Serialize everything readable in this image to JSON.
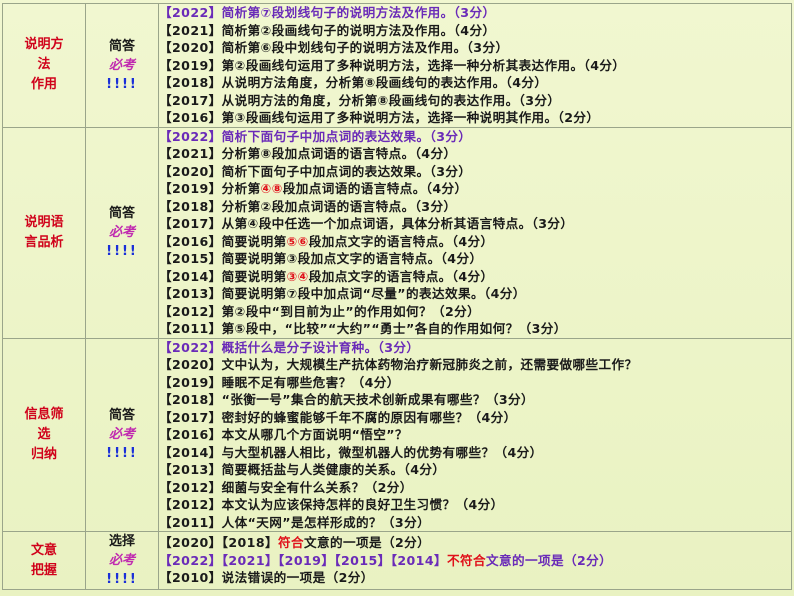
{
  "sections": [
    {
      "category_lines": [
        "说明方",
        "法",
        "作用"
      ],
      "type": "简答",
      "must": "必考",
      "marks": "!!!!",
      "items": [
        {
          "year": "【2022】",
          "text": "简析第⑦段划线句子的说明方法及作用。（3分）",
          "highlight": true
        },
        {
          "year": "【2021】",
          "text": "简析第②段画线句子的说明方法及作用。（4分）"
        },
        {
          "year": "【2020】",
          "text": "简析第⑥段中划线句子的说明方法及作用。（3分）"
        },
        {
          "year": "【2019】",
          "text": "第②段画线句运用了多种说明方法，选择一种分析其表达作用。（4分）"
        },
        {
          "year": "【2018】",
          "text": "从说明方法角度，分析第⑧段画线句的表达作用。（4分）"
        },
        {
          "year": "【2017】",
          "text": "从说明方法的角度，分析第⑧段画线句的表达作用。（3分）"
        },
        {
          "year": "【2016】",
          "text": "第③段画线句运用了多种说明方法，选择一种说明其作用。（2分）"
        }
      ]
    },
    {
      "category_lines": [
        "说明语",
        "言品析"
      ],
      "type": "简答",
      "must": "必考",
      "marks": "!!!!",
      "items": [
        {
          "year": "【2022】",
          "text": "简析下面句子中加点词的表达效果。（3分）",
          "highlight": true
        },
        {
          "year": "【2021】",
          "text": "分析第⑧段加点词语的语言特点。（4分）"
        },
        {
          "year": "【2020】",
          "text": "简析下面句子中加点词的表达效果。（3分）"
        },
        {
          "year": "【2019】",
          "pre": "分析第",
          "red": "④⑧",
          "post": "段加点词语的语言特点。（4分）"
        },
        {
          "year": "【2018】",
          "text": "分析第②段加点词语的语言特点。（3分）"
        },
        {
          "year": "【2017】",
          "text": "从第④段中任选一个加点词语，具体分析其语言特点。（3分）"
        },
        {
          "year": "【2016】",
          "pre": "简要说明第",
          "red": "⑤⑥",
          "post": "段加点文字的语言特点。（4分）"
        },
        {
          "year": "【2015】",
          "text": "简要说明第③段加点文字的语言特点。（4分）"
        },
        {
          "year": "【2014】",
          "pre": "简要说明第",
          "red": "③④",
          "post": "段加点文字的语言特点。（4分）"
        },
        {
          "year": "【2013】",
          "text": "简要说明第⑦段中加点词“尽量”的表达效果。（4分）"
        },
        {
          "year": "【2012】",
          "text": "第②段中“到目前为止”的作用如何？（2分）"
        },
        {
          "year": "【2011】",
          "text": "第⑤段中，“比较”“大约”“勇士”各自的作用如何？（3分）"
        }
      ]
    },
    {
      "category_lines": [
        "信息筛",
        "选",
        "归纳"
      ],
      "type": "简答",
      "must": "必考",
      "marks": "!!!!",
      "items": [
        {
          "year": "【2022】",
          "text": "概括什么是分子设计育种。（3分）",
          "highlight": true
        },
        {
          "year": "【2020】",
          "text": "文中认为，大规模生产抗体药物治疗新冠肺炎之前，还需要做哪些工作？"
        },
        {
          "year": "【2019】",
          "text": "睡眠不足有哪些危害？（4分）"
        },
        {
          "year": "【2018】",
          "text": "“张衡一号”集合的航天技术创新成果有哪些？（3分）"
        },
        {
          "year": "【2017】",
          "text": "密封好的蜂蜜能够千年不腐的原因有哪些？（4分）"
        },
        {
          "year": "【2016】",
          "text": "本文从哪几个方面说明“悟空”？"
        },
        {
          "year": "【2014】",
          "text": "与大型机器人相比，微型机器人的优势有哪些？（4分）"
        },
        {
          "year": "【2013】",
          "text": "简要概括盐与人类健康的关系。（4分）"
        },
        {
          "year": "【2012】",
          "text": "细菌与安全有什么关系？（2分）"
        },
        {
          "year": "【2012】",
          "text": "本文认为应该保持怎样的良好卫生习惯？（4分）"
        },
        {
          "year": "【2011】",
          "text": "人体“天网”是怎样形成的？（3分）"
        }
      ]
    },
    {
      "category_lines": [
        "文意",
        "把握"
      ],
      "type": "选择",
      "must": "必考",
      "marks": "!!!!",
      "items": [
        {
          "year": "【2020】【2018】",
          "red": "符合",
          "post": "文意的一项是（2分）"
        },
        {
          "year": "【2022】",
          "year2": "【2021】【2019】【2015】【2014】",
          "red": "不符合",
          "post": "文意的一项是（2分）",
          "highlight": true
        },
        {
          "year": "【2010】",
          "text": "说法错误的一项是（2分）"
        }
      ]
    }
  ]
}
